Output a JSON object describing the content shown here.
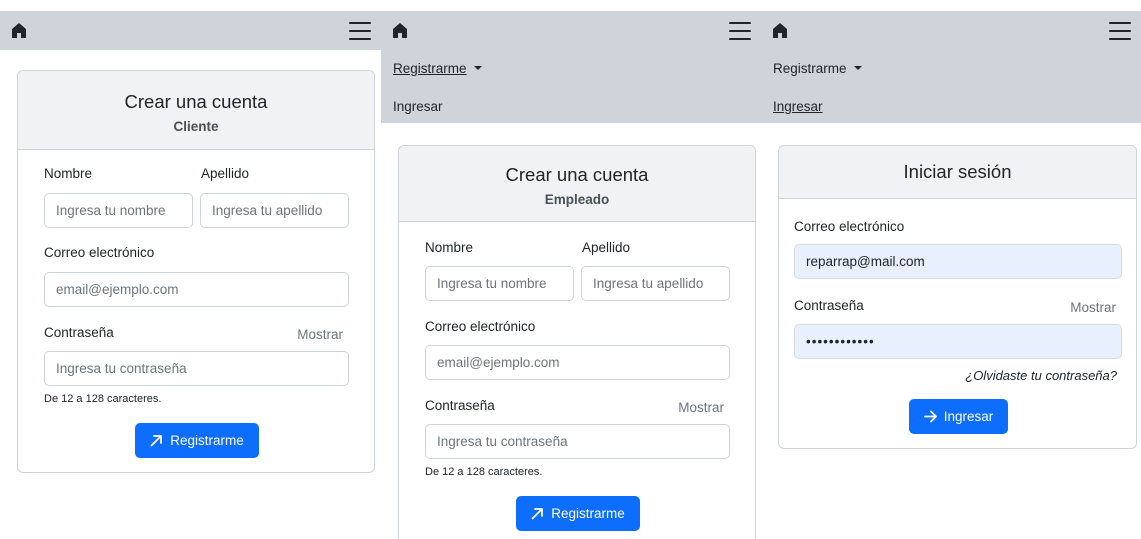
{
  "icons": {
    "home": "home-icon",
    "menu": "hamburger-menu-icon",
    "signup": "arrow-up-right-icon",
    "login": "arrow-right-icon",
    "caret": "caret-down-icon"
  },
  "colors": {
    "topbar": "#ced4da",
    "primary": "#0d6efd",
    "autofill": "#e8f0fe",
    "card_header": "#f1f2f4"
  },
  "nav": {
    "register": "Registrarme",
    "login": "Ingresar"
  },
  "client_form": {
    "title": "Crear una cuenta",
    "subtitle": "Cliente",
    "first_name_label": "Nombre",
    "first_name_placeholder": "Ingresa tu nombre",
    "last_name_label": "Apellido",
    "last_name_placeholder": "Ingresa tu apellido",
    "email_label": "Correo electrónico",
    "email_placeholder": "email@ejemplo.com",
    "password_label": "Contraseña",
    "show_label": "Mostrar",
    "password_placeholder": "Ingresa tu contraseña",
    "password_help": "De 12 a 128 caracteres.",
    "submit": "Registrarme"
  },
  "employee_form": {
    "title": "Crear una cuenta",
    "subtitle": "Empleado",
    "first_name_label": "Nombre",
    "first_name_placeholder": "Ingresa tu nombre",
    "last_name_label": "Apellido",
    "last_name_placeholder": "Ingresa tu apellido",
    "email_label": "Correo electrónico",
    "email_placeholder": "email@ejemplo.com",
    "password_label": "Contraseña",
    "show_label": "Mostrar",
    "password_placeholder": "Ingresa tu contraseña",
    "password_help": "De 12 a 128 caracteres.",
    "submit": "Registrarme"
  },
  "login_form": {
    "title": "Iniciar sesión",
    "email_label": "Correo electrónico",
    "email_value": "reparrap@mail.com",
    "password_label": "Contraseña",
    "show_label": "Mostrar",
    "password_value": "••••••••••••",
    "forgot": "¿Olvidaste tu contraseña?",
    "submit": "Ingresar"
  }
}
